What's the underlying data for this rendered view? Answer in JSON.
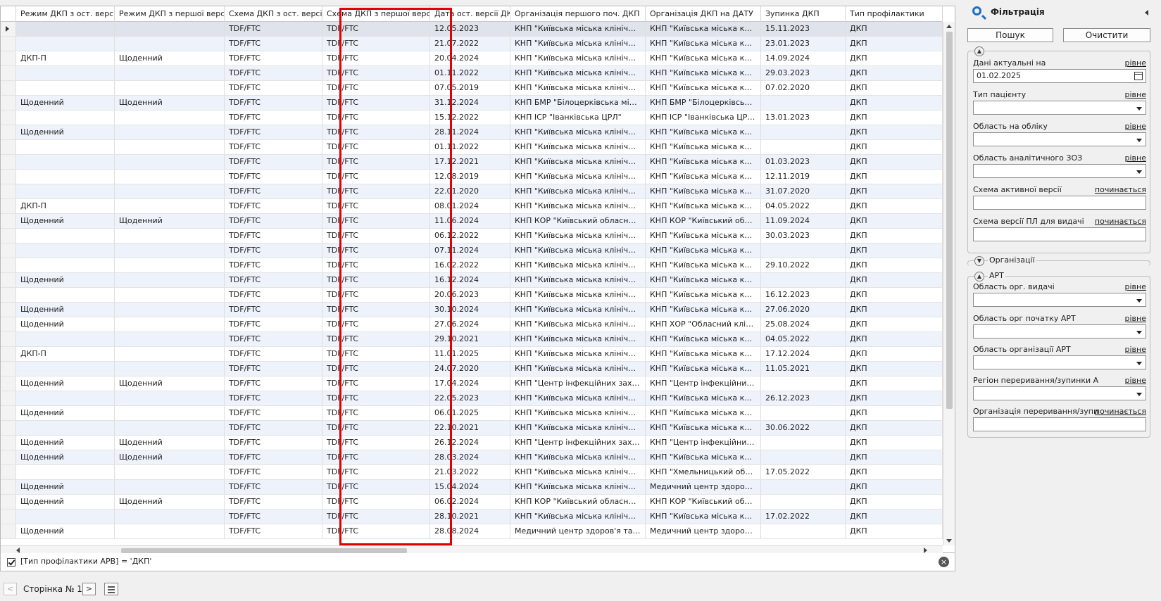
{
  "grid": {
    "columns": [
      {
        "key": "c1",
        "label": "Режим ДКП з ост. версії"
      },
      {
        "key": "c2",
        "label": "Режим ДКП з першої версії"
      },
      {
        "key": "c3",
        "label": "Схема ДКП з ост. версії"
      },
      {
        "key": "c4",
        "label": "Схема ДКП з першої версії"
      },
      {
        "key": "c5",
        "label": "Дата ост. версії ДКП"
      },
      {
        "key": "c6",
        "label": "Організація першого поч. ДКП"
      },
      {
        "key": "c7",
        "label": "Організація ДКП на ДАТУ"
      },
      {
        "key": "c8",
        "label": "Зупинка ДКП"
      },
      {
        "key": "c9",
        "label": "Тип профілактики"
      }
    ],
    "rows": [
      [
        "",
        "",
        "TDF/FTC",
        "TDF/FTC",
        "12.05.2023",
        "КНП \"Київська міська клінічна л...",
        "КНП \"Київська міська клініч...",
        "15.11.2023",
        "ДКП"
      ],
      [
        "",
        "",
        "TDF/FTC",
        "TDF/FTC",
        "21.07.2022",
        "КНП \"Київська міська клінічна л...",
        "КНП \"Київська міська клініч...",
        "23.01.2023",
        "ДКП"
      ],
      [
        "ДКП-П",
        "Щоденний",
        "TDF/FTC",
        "TDF/FTC",
        "20.04.2024",
        "КНП \"Київська міська клінічна л...",
        "КНП \"Київська міська клініч...",
        "14.09.2024",
        "ДКП"
      ],
      [
        "",
        "",
        "TDF/FTC",
        "TDF/FTC",
        "01.11.2022",
        "КНП \"Київська міська клінічна л...",
        "КНП \"Київська міська клініч...",
        "29.03.2023",
        "ДКП"
      ],
      [
        "",
        "",
        "TDF/FTC",
        "TDF/FTC",
        "07.05.2019",
        "КНП \"Київська міська клінічна л...",
        "КНП \"Київська міська клініч...",
        "07.02.2020",
        "ДКП"
      ],
      [
        "Щоденний",
        "Щоденний",
        "TDF/FTC",
        "TDF/FTC",
        "31.12.2024",
        "КНП БМР \"Білоцерківська міськ...",
        "КНП БМР \"Білоцерківська...",
        "",
        "ДКП"
      ],
      [
        "",
        "",
        "TDF/FTC",
        "TDF/FTC",
        "15.12.2022",
        "КНП ІСР \"Іванківська ЦРЛ\"",
        "КНП ІСР \"Іванківська ЦРЛ\"",
        "13.01.2023",
        "ДКП"
      ],
      [
        "Щоденний",
        "",
        "TDF/FTC",
        "TDF/FTC",
        "28.11.2024",
        "КНП \"Київська міська клінічна л...",
        "КНП \"Київська міська клініч...",
        "",
        "ДКП"
      ],
      [
        "",
        "",
        "TDF/FTC",
        "TDF/FTC",
        "01.11.2022",
        "КНП \"Київська міська клінічна л...",
        "КНП \"Київська міська клініч...",
        "",
        "ДКП"
      ],
      [
        "",
        "",
        "TDF/FTC",
        "TDF/FTC",
        "17.12.2021",
        "КНП \"Київська міська клінічна л...",
        "КНП \"Київська міська клініч...",
        "01.03.2023",
        "ДКП"
      ],
      [
        "",
        "",
        "TDF/FTC",
        "TDF/FTC",
        "12.08.2019",
        "КНП \"Київська міська клінічна л...",
        "КНП \"Київська міська клініч...",
        "12.11.2019",
        "ДКП"
      ],
      [
        "",
        "",
        "TDF/FTC",
        "TDF/FTC",
        "22.01.2020",
        "КНП \"Київська міська клінічна л...",
        "КНП \"Київська міська клініч...",
        "31.07.2020",
        "ДКП"
      ],
      [
        "ДКП-П",
        "",
        "TDF/FTC",
        "TDF/FTC",
        "08.01.2024",
        "КНП \"Київська міська клінічна л...",
        "КНП \"Київська міська клініч...",
        "04.05.2022",
        "ДКП"
      ],
      [
        "Щоденний",
        "Щоденний",
        "TDF/FTC",
        "TDF/FTC",
        "11.06.2024",
        "КНП КОР \"Київський обласний...",
        "КНП КОР \"Київський облас...",
        "11.09.2024",
        "ДКП"
      ],
      [
        "",
        "",
        "TDF/FTC",
        "TDF/FTC",
        "06.12.2022",
        "КНП \"Київська міська клінічна л...",
        "КНП \"Київська міська клініч...",
        "30.03.2023",
        "ДКП"
      ],
      [
        "",
        "",
        "TDF/FTC",
        "TDF/FTC",
        "07.11.2024",
        "КНП \"Київська міська клінічна л...",
        "КНП \"Київська міська клініч...",
        "",
        "ДКП"
      ],
      [
        "",
        "",
        "TDF/FTC",
        "TDF/FTC",
        "16.02.2022",
        "КНП \"Київська міська клінічна л...",
        "КНП \"Київська міська клініч...",
        "29.10.2022",
        "ДКП"
      ],
      [
        "Щоденний",
        "",
        "TDF/FTC",
        "TDF/FTC",
        "16.12.2024",
        "КНП \"Київська міська клінічна л...",
        "КНП \"Київська міська клініч...",
        "",
        "ДКП"
      ],
      [
        "",
        "",
        "TDF/FTC",
        "TDF/FTC",
        "20.06.2023",
        "КНП \"Київська міська клінічна л...",
        "КНП \"Київська міська клініч...",
        "16.12.2023",
        "ДКП"
      ],
      [
        "Щоденний",
        "",
        "TDF/FTC",
        "TDF/FTC",
        "30.10.2024",
        "КНП \"Київська міська клінічна л...",
        "КНП \"Київська міська клініч...",
        "27.06.2020",
        "ДКП"
      ],
      [
        "Щоденний",
        "",
        "TDF/FTC",
        "TDF/FTC",
        "27.06.2024",
        "КНП \"Київська міська клінічна л...",
        "КНП ХОР \"Обласний клініч...",
        "25.08.2024",
        "ДКП"
      ],
      [
        "",
        "",
        "TDF/FTC",
        "TDF/FTC",
        "29.10.2021",
        "КНП \"Київська міська клінічна л...",
        "КНП \"Київська міська клініч...",
        "04.05.2022",
        "ДКП"
      ],
      [
        "ДКП-П",
        "",
        "TDF/FTC",
        "TDF/FTC",
        "11.01.2025",
        "КНП \"Київська міська клінічна л...",
        "КНП \"Київська міська клініч...",
        "17.12.2024",
        "ДКП"
      ],
      [
        "",
        "",
        "TDF/FTC",
        "TDF/FTC",
        "24.07.2020",
        "КНП \"Київська міська клінічна л...",
        "КНП \"Київська міська клініч...",
        "11.05.2021",
        "ДКП"
      ],
      [
        "Щоденний",
        "Щоденний",
        "TDF/FTC",
        "TDF/FTC",
        "17.04.2024",
        "КНП \"Центр інфекційних захвор...",
        "КНП \"Центр інфекційних з...",
        "",
        "ДКП"
      ],
      [
        "",
        "",
        "TDF/FTC",
        "TDF/FTC",
        "22.05.2023",
        "КНП \"Київська міська клінічна л...",
        "КНП \"Київська міська клініч...",
        "26.12.2023",
        "ДКП"
      ],
      [
        "Щоденний",
        "",
        "TDF/FTC",
        "TDF/FTC",
        "06.01.2025",
        "КНП \"Київська міська клінічна л...",
        "КНП \"Київська міська клініч...",
        "",
        "ДКП"
      ],
      [
        "",
        "",
        "TDF/FTC",
        "TDF/FTC",
        "22.10.2021",
        "КНП \"Київська міська клінічна л...",
        "КНП \"Київська міська клініч...",
        "30.06.2022",
        "ДКП"
      ],
      [
        "Щоденний",
        "Щоденний",
        "TDF/FTC",
        "TDF/FTC",
        "26.12.2024",
        "КНП \"Центр інфекційних захвор...",
        "КНП \"Центр інфекційних з...",
        "",
        "ДКП"
      ],
      [
        "Щоденний",
        "Щоденний",
        "TDF/FTC",
        "TDF/FTC",
        "28.03.2024",
        "КНП \"Київська міська клінічна л...",
        "КНП \"Київська міська клініч...",
        "",
        "ДКП"
      ],
      [
        "",
        "",
        "TDF/FTC",
        "TDF/FTC",
        "21.03.2022",
        "КНП \"Київська міська клінічна л...",
        "КНП \"Хмельницький облас...",
        "17.05.2022",
        "ДКП"
      ],
      [
        "Щоденний",
        "",
        "TDF/FTC",
        "TDF/FTC",
        "15.04.2024",
        "КНП \"Київська міська клінічна л...",
        "Медичний центр здоров'я...",
        "",
        "ДКП"
      ],
      [
        "Щоденний",
        "Щоденний",
        "TDF/FTC",
        "TDF/FTC",
        "06.02.2024",
        "КНП КОР \"Київський обласний...",
        "КНП КОР \"Київський облас...",
        "",
        "ДКП"
      ],
      [
        "",
        "",
        "TDF/FTC",
        "TDF/FTC",
        "28.10.2021",
        "КНП \"Київська міська клінічна л...",
        "КНП \"Київська міська клініч...",
        "17.02.2022",
        "ДКП"
      ],
      [
        "Щоденний",
        "",
        "TDF/FTC",
        "TDF/FTC",
        "28.08.2024",
        "Медичний центр здоров'я та ре...",
        "Медичний центр здоров'я...",
        "",
        "ДКП"
      ]
    ]
  },
  "filter_bar": {
    "text": "[Тип профілактики АРВ] = 'ДКП'"
  },
  "pager": {
    "prev": "<",
    "page_label": "Сторінка № 1",
    "next": ">"
  },
  "panel": {
    "title": "Фільтрація",
    "search_button": "Пошук",
    "clear_button": "Очистити",
    "groups": {
      "organizations": "Організації",
      "art": "АРТ"
    },
    "fields": {
      "data_actual": {
        "label": "Дані актуальні на",
        "op": "рівне",
        "value": "01.02.2025"
      },
      "patient_type": {
        "label": "Тип пацієнту",
        "op": "рівне",
        "value": ""
      },
      "region_registered": {
        "label": "Область на обліку",
        "op": "рівне",
        "value": ""
      },
      "region_analytic": {
        "label": "Область аналітичного ЗОЗ",
        "op": "рівне",
        "value": ""
      },
      "scheme_active": {
        "label": "Схема активної версії",
        "op": "починається",
        "value": ""
      },
      "scheme_pl": {
        "label": "Схема версії ПЛ для видачі",
        "op": "починається",
        "value": ""
      },
      "region_org_issue": {
        "label": "Область орг. видачі",
        "op": "рівне",
        "value": ""
      },
      "region_org_art_start": {
        "label": "Область орг початку АРТ",
        "op": "рівне",
        "value": ""
      },
      "region_org_art": {
        "label": "Область організації АРТ",
        "op": "рівне",
        "value": ""
      },
      "region_interrupt": {
        "label": "Регіон переривання/зупинки А",
        "op": "рівне",
        "value": ""
      },
      "org_interrupt": {
        "label": "Організація переривання/зупи",
        "op": "починається",
        "value": ""
      }
    }
  },
  "colors": {
    "highlight": "#e00000",
    "row_alt": "#eef2fb",
    "accent": "#1b6ec2"
  }
}
